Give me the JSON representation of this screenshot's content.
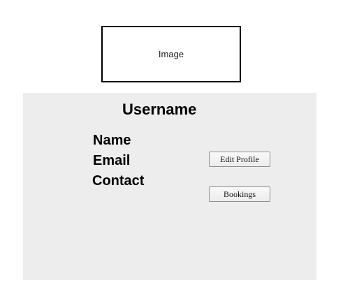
{
  "image_placeholder": {
    "label": "Image"
  },
  "profile": {
    "username": "Username",
    "fields": {
      "name": "Name",
      "email": "Email",
      "contact": "Contact"
    }
  },
  "actions": {
    "edit_profile_label": "Edit Profile",
    "bookings_label": "Bookings"
  },
  "colors": {
    "panel_background": "#ededed",
    "page_background": "#ffffff"
  }
}
